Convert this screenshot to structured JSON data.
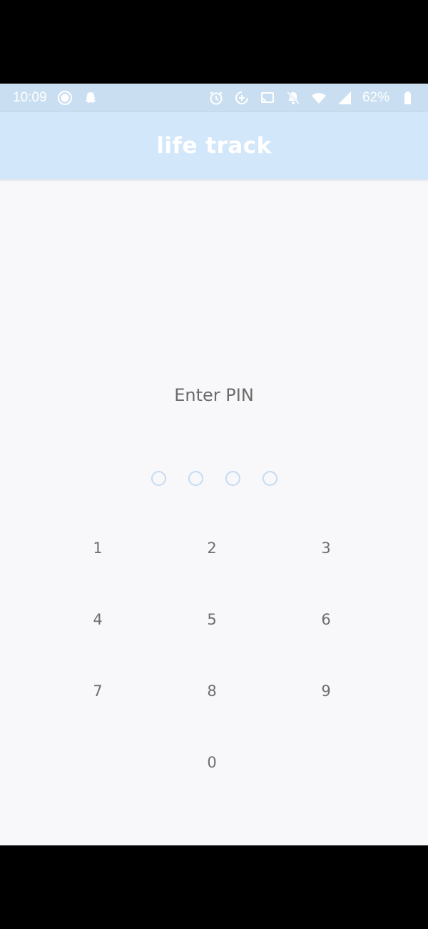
{
  "status_bar": {
    "time": "10:09",
    "battery": "62%",
    "left_icons": [
      "record-icon",
      "snapchat-icon"
    ],
    "right_icons": [
      "alarm-icon",
      "data-saver-icon",
      "cast-icon",
      "notifications-off-icon",
      "wifi-icon",
      "signal-icon",
      "battery-icon"
    ]
  },
  "app_bar": {
    "title": "life track"
  },
  "pin": {
    "label": "Enter PIN",
    "length": 4
  },
  "keypad": {
    "keys": [
      "1",
      "2",
      "3",
      "4",
      "5",
      "6",
      "7",
      "8",
      "9",
      "0"
    ]
  },
  "colors": {
    "status_bar_bg": "#c9def0",
    "app_bar_bg": "#d3e7fb",
    "screen_bg": "#f8f7f9",
    "dot_border": "#c5dcf1",
    "text": "#6b6b6b"
  }
}
